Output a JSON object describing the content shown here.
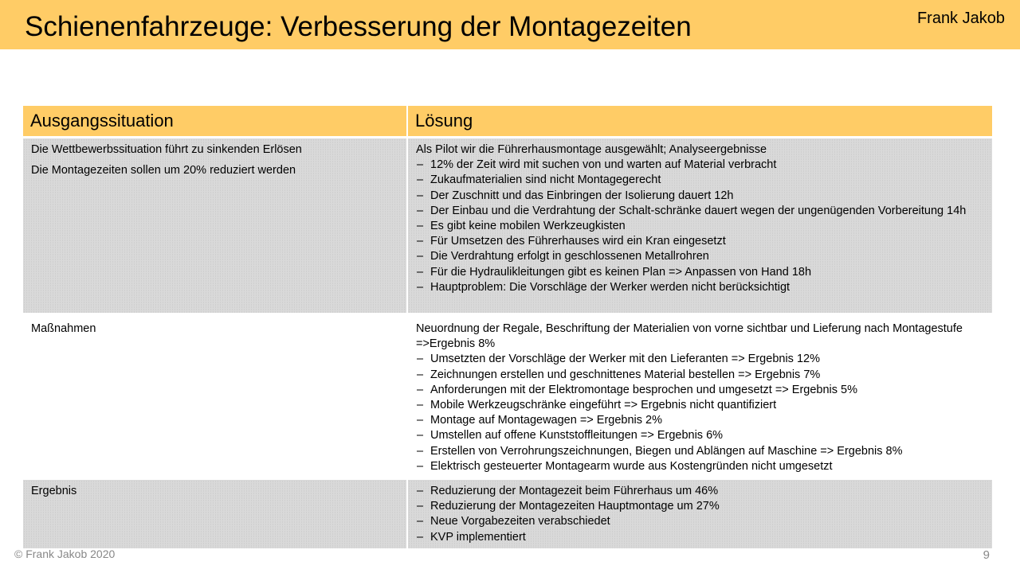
{
  "header": {
    "title": "Schienenfahrzeuge: Verbesserung der Montagezeiten",
    "author": "Frank Jakob"
  },
  "table": {
    "columns": [
      "Ausgangssituation",
      "Lösung"
    ],
    "rows": [
      {
        "left": [
          "Die Wettbewerbssituation führt zu sinkenden Erlösen",
          "Die Montagezeiten sollen um 20% reduziert werden"
        ],
        "right_intro": "Als Pilot wir die Führerhausmontage ausgewählt; Analyseergebnisse",
        "right_items": [
          "12% der Zeit wird mit suchen von und warten auf Material verbracht",
          "Zukaufmaterialien sind nicht Montagegerecht",
          "Der Zuschnitt und das Einbringen der Isolierung dauert 12h",
          "Der Einbau und die Verdrahtung der Schalt-schränke dauert wegen der ungenügenden Vorbereitung 14h",
          "Es gibt keine mobilen Werkzeugkisten",
          "Für Umsetzen des Führerhauses wird ein Kran eingesetzt",
          "Die Verdrahtung erfolgt in geschlossenen Metallrohren",
          "Für die Hydraulikleitungen gibt es keinen Plan => Anpassen von Hand 18h",
          "Hauptproblem: Die Vorschläge der Werker werden nicht berücksichtigt"
        ]
      },
      {
        "left": [
          "Maßnahmen"
        ],
        "right_intro": "Neuordnung der Regale, Beschriftung der Materialien von vorne sichtbar und Lieferung nach Montagestufe =>Ergebnis 8%",
        "right_items": [
          "Umsetzten der Vorschläge der Werker mit den Lieferanten => Ergebnis 12%",
          "Zeichnungen erstellen und geschnittenes Material bestellen => Ergebnis 7%",
          "Anforderungen mit der Elektromontage besprochen und umgesetzt => Ergebnis 5%",
          "Mobile Werkzeugschränke eingeführt => Ergebnis nicht quantifiziert",
          "Montage auf Montagewagen => Ergebnis 2%",
          "Umstellen auf offene Kunststoffleitungen => Ergebnis 6%",
          "Erstellen von Verrohrungszeichnungen, Biegen und Ablängen auf Maschine => Ergebnis 8%",
          "Elektrisch gesteuerter Montagearm wurde aus Kostengründen nicht umgesetzt"
        ]
      },
      {
        "left": [
          "Ergebnis"
        ],
        "right_items": [
          "Reduzierung der Montagezeit beim Führerhaus um 46%",
          "Reduzierung der Montagezeiten Hauptmontage um 27%",
          "Neue Vorgabezeiten verabschiedet",
          "KVP implementiert"
        ]
      }
    ],
    "dash": "–"
  },
  "footer": {
    "copyright": "© Frank Jakob 2020",
    "page_number": "9"
  },
  "colors": {
    "accent": "#FFCC66",
    "row_shade": "#D9D9D9",
    "footer_text": "#888888"
  }
}
